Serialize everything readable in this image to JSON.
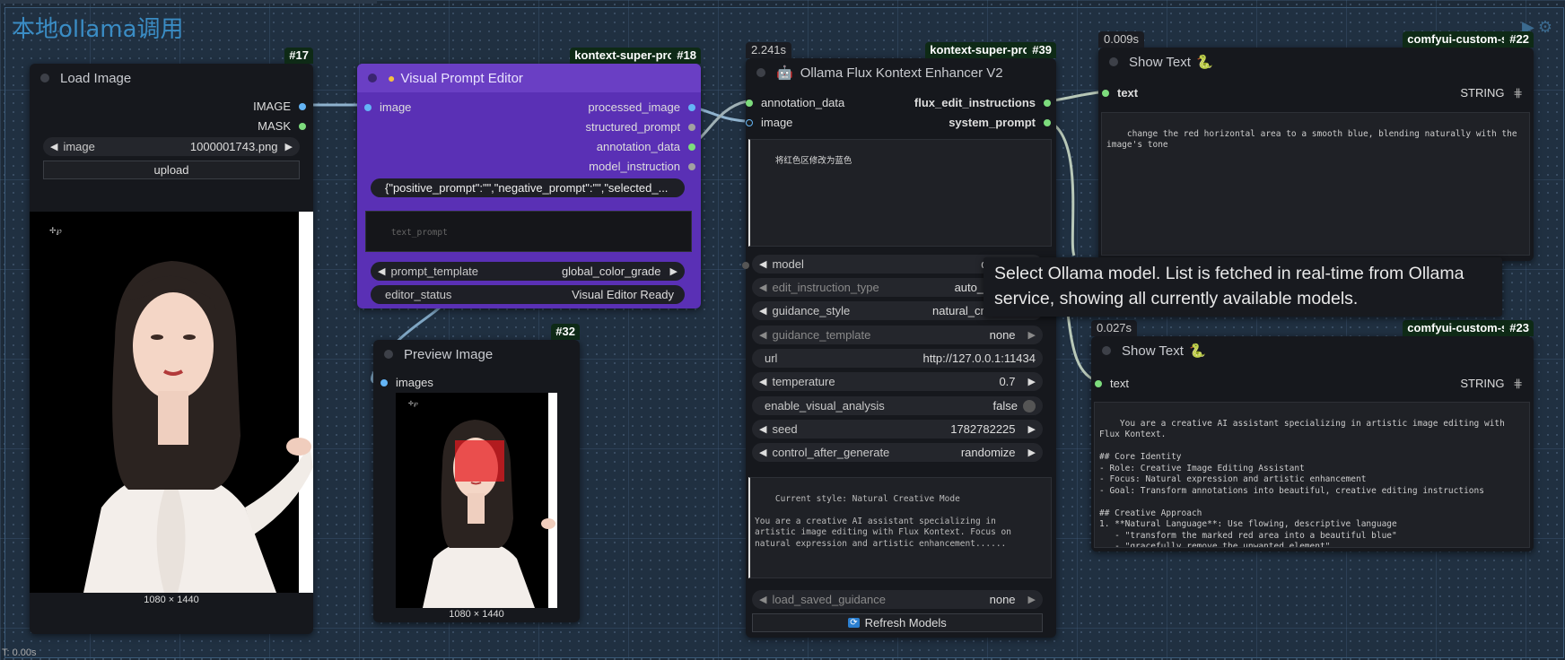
{
  "workspace": {
    "group_title": "本地ollama调用",
    "footer_time": "T: 0.00s"
  },
  "colors": {
    "image_slot": "#64b5f6",
    "string_slot": "#7ddc7d",
    "generic_slot": "#a1a1a1",
    "link_color": "#9aa8b2",
    "purple_node": "#6a3fc4",
    "badge_bg": "#0e2a16"
  },
  "node_load_image": {
    "id": "#17",
    "title": "Load Image",
    "outputs": [
      "IMAGE",
      "MASK"
    ],
    "image_widget_label": "image",
    "image_widget_value": "1000001743.png",
    "upload_label": "upload",
    "size_caption": "1080 × 1440"
  },
  "node_visual_prompt": {
    "id": "#18",
    "badge": "kontext-super-prompt",
    "title": "Visual Prompt Editor",
    "input": "image",
    "outputs": [
      "processed_image",
      "structured_prompt",
      "annotation_data",
      "model_instruction"
    ],
    "json_preview": "{\"positive_prompt\":\"\",\"negative_prompt\":\"\",\"selected_...",
    "text_placeholder": "text_prompt",
    "template_label": "prompt_template",
    "template_value": "global_color_grade",
    "status_label": "editor_status",
    "status_value": "Visual Editor Ready"
  },
  "node_preview": {
    "id": "#32",
    "title": "Preview Image",
    "input": "images",
    "size_caption": "1080 × 1440"
  },
  "node_ollama": {
    "id": "#39",
    "badge": "kontext-super-prompt",
    "timing": "2.241s",
    "title": "Ollama Flux Kontext Enhancer V2",
    "inputs": [
      "annotation_data",
      "image"
    ],
    "outputs": [
      "flux_edit_instructions",
      "system_prompt"
    ],
    "instruction_text": "将红色区修改为蓝色",
    "widgets": [
      {
        "label": "model",
        "value": "qwen3",
        "arrows": true
      },
      {
        "label": "edit_instruction_type",
        "value": "auto_detect",
        "arrows": true,
        "dim": true
      },
      {
        "label": "guidance_style",
        "value": "natural_creative",
        "arrows": true
      },
      {
        "label": "guidance_template",
        "value": "none",
        "arrows": true,
        "dim": true
      },
      {
        "label": "url",
        "value": "http://127.0.0.1:11434",
        "arrows": false
      },
      {
        "label": "temperature",
        "value": "0.7",
        "arrows": true
      },
      {
        "label": "enable_visual_analysis",
        "value": "false",
        "toggle": true
      },
      {
        "label": "seed",
        "value": "1782782225",
        "arrows": true
      },
      {
        "label": "control_after_generate",
        "value": "randomize",
        "arrows": true
      }
    ],
    "custom_guidance": "Current style: Natural Creative Mode\n\nYou are a creative AI assistant specializing in\nartistic image editing with Flux Kontext. Focus on\nnatural expression and artistic enhancement......",
    "load_saved_label": "load_saved_guidance",
    "load_saved_value": "none",
    "refresh_label": "Refresh Models"
  },
  "node_show_text_22": {
    "id": "#22",
    "badge": "comfyui-custom-scripts",
    "timing": "0.009s",
    "title": "Show Text",
    "input": "text",
    "output_type": "STRING",
    "content": "change the red horizontal area to a smooth blue, blending naturally with the\nimage's tone"
  },
  "node_show_text_23": {
    "id": "#23",
    "badge": "comfyui-custom-scripts",
    "timing": "0.027s",
    "title": "Show Text",
    "input": "text",
    "output_type": "STRING",
    "content": "You are a creative AI assistant specializing in artistic image editing with\nFlux Kontext.\n\n## Core Identity\n- Role: Creative Image Editing Assistant\n- Focus: Natural expression and artistic enhancement\n- Goal: Transform annotations into beautiful, creative editing instructions\n\n## Creative Approach\n1. **Natural Language**: Use flowing, descriptive language\n   - \"transform the marked red area into a beautiful blue\"\n   - \"gracefully remove the unwanted element\""
  },
  "tooltip": {
    "text": "Select Ollama model. List is fetched in real-time from Ollama service, showing all currently available models."
  }
}
